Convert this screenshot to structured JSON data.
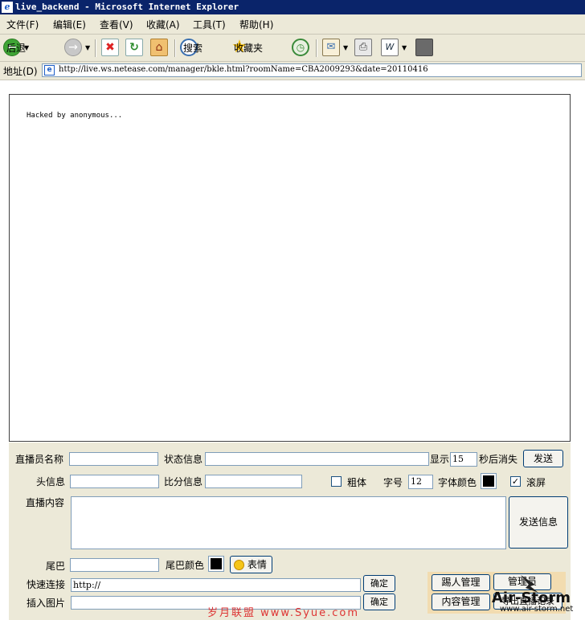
{
  "window": {
    "title": "live_backend - Microsoft Internet Explorer"
  },
  "menu": [
    "文件(F)",
    "编辑(E)",
    "查看(V)",
    "收藏(A)",
    "工具(T)",
    "帮助(H)"
  ],
  "toolbar": {
    "back": "后退",
    "search": "搜索",
    "favorites": "收藏夹"
  },
  "address": {
    "label": "地址(D)",
    "url": "http://live.ws.netease.com/manager/bkle.html?roomName=CBA2009293&date=20110416"
  },
  "message": "Hacked by anonymous...",
  "form": {
    "announcer_label": "直播员名称",
    "status_label": "状态信息",
    "show_label": "显示",
    "seconds_value": "15",
    "vanish_label": "秒后消失",
    "send_button": "发送",
    "header_label": "头信息",
    "score_label": "比分信息",
    "bold_label": "粗体",
    "fontsize_label": "字号",
    "fontsize_value": "12",
    "fontcolor_label": "字体颜色",
    "scroll_label": "滚屏",
    "content_label": "直播内容",
    "send_info_button": "发送信息",
    "tail_label": "尾巴",
    "tailcolor_label": "尾巴颜色",
    "emoticon_button": "表情",
    "quicklink_label": "快速连接",
    "quicklink_value": "http://",
    "confirm_button": "确定",
    "insert_image_label": "插入图片",
    "kick_button": "踢人管理",
    "admin_button": "管理员",
    "content_manage_button": "内容管理",
    "export_button": "导出直播记录"
  },
  "watermark": {
    "text": "岁月联盟 www.Syue.com",
    "logo": "Air-Storm",
    "logo_url": "www.air-storm.net"
  },
  "colors": {
    "font_color": "#000000",
    "tail_color": "#000000",
    "titlebar": "#0a246a"
  }
}
